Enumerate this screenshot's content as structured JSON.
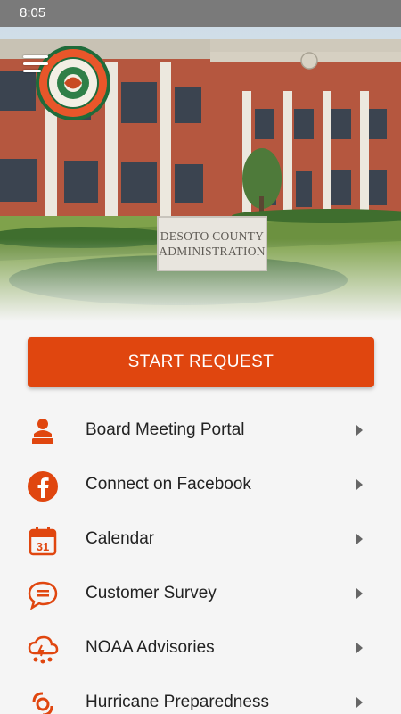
{
  "status_bar": {
    "time": "8:05"
  },
  "hero": {
    "sign_line1": "DESOTO COUNTY",
    "sign_line2": "ADMINISTRATION"
  },
  "start_request": {
    "label": "START REQUEST"
  },
  "menu": [
    {
      "label": "Board Meeting Portal",
      "icon": "speaker-podium-icon"
    },
    {
      "label": "Connect on Facebook",
      "icon": "facebook-icon"
    },
    {
      "label": "Calendar",
      "icon": "calendar-icon",
      "icon_text": "31"
    },
    {
      "label": "Customer Survey",
      "icon": "chat-bubble-icon"
    },
    {
      "label": "NOAA Advisories",
      "icon": "weather-cloud-icon"
    },
    {
      "label": "Hurricane Preparedness",
      "icon": "hurricane-icon"
    }
  ],
  "colors": {
    "accent": "#e0460f",
    "status_bar": "#7a7a7a"
  }
}
